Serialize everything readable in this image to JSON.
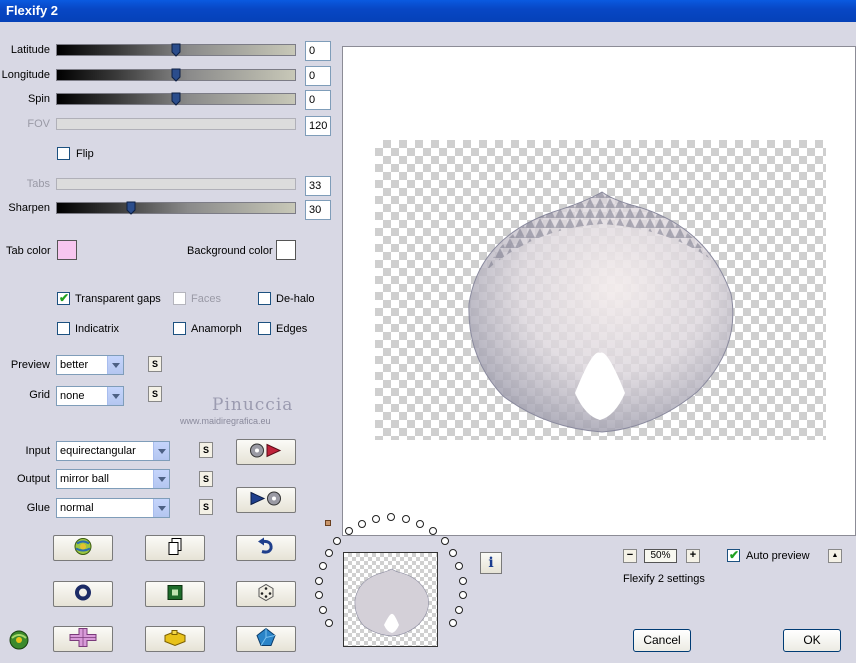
{
  "window": {
    "title": "Flexify 2"
  },
  "sliders": [
    {
      "label": "Latitude",
      "value": "0",
      "position": 0.5,
      "disabled": false
    },
    {
      "label": "Longitude",
      "value": "0",
      "position": 0.5,
      "disabled": false
    },
    {
      "label": "Spin",
      "value": "0",
      "position": 0.5,
      "disabled": false
    },
    {
      "label": "FOV",
      "value": "120",
      "position": 0.0,
      "disabled": true
    },
    {
      "label": "Tabs",
      "value": "33",
      "position": 0.0,
      "disabled": true
    },
    {
      "label": "Sharpen",
      "value": "30",
      "position": 0.3,
      "disabled": false
    }
  ],
  "flip": {
    "label": "Flip",
    "checked": false
  },
  "colors": {
    "tab_color_label": "Tab color",
    "tab_color": "#f7c6ef",
    "background_color_label": "Background color",
    "background_color": "#ffffff"
  },
  "options": {
    "transparent_gaps": {
      "label": "Transparent gaps",
      "checked": true
    },
    "faces": {
      "label": "Faces",
      "checked": false,
      "disabled": true
    },
    "de_halo": {
      "label": "De-halo",
      "checked": false
    },
    "indicatrix": {
      "label": "Indicatrix",
      "checked": false
    },
    "anamorph": {
      "label": "Anamorph",
      "checked": false
    },
    "edges": {
      "label": "Edges",
      "checked": false
    }
  },
  "preview_select": {
    "label": "Preview",
    "value": "better"
  },
  "grid_select": {
    "label": "Grid",
    "value": "none"
  },
  "input_select": {
    "label": "Input",
    "value": "equirectangular"
  },
  "output_select": {
    "label": "Output",
    "value": "mirror ball"
  },
  "glue_select": {
    "label": "Glue",
    "value": "normal"
  },
  "small_button_label": "S",
  "watermark": {
    "name": "Pinuccia",
    "url": "www.maidiregrafica.eu"
  },
  "zoom": {
    "value": "50%",
    "minus": "−",
    "plus": "+"
  },
  "auto_preview": {
    "label": "Auto preview",
    "checked": true
  },
  "scroll_up": "▲",
  "info_label": "i",
  "settings_text": "Flexify 2 settings",
  "cancel_label": "Cancel",
  "ok_label": "OK",
  "icons": [
    "film-reel-play-icon",
    "play-film-reel-icon",
    "globe-icon",
    "copy-icon",
    "undo-icon",
    "ring-icon",
    "square-icon",
    "dice-icon",
    "cross-icon",
    "puzzle-icon",
    "pentagon-icon",
    "plugin-logo-icon"
  ]
}
